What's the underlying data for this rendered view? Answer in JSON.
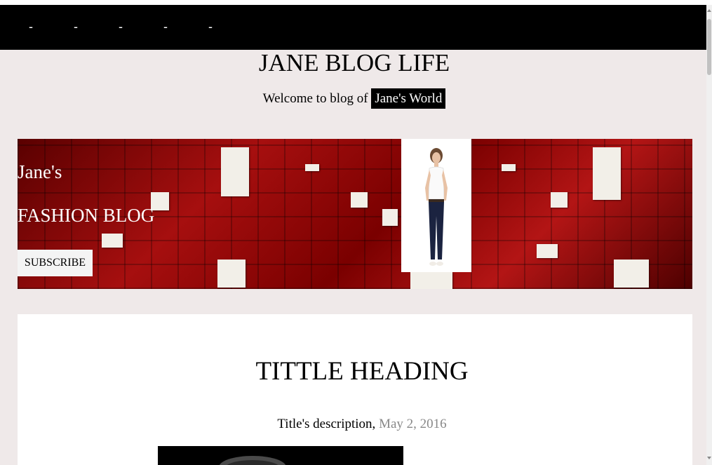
{
  "nav": {
    "items": [
      "-",
      "-",
      "-",
      "-",
      "-"
    ]
  },
  "header": {
    "title": "JANE BLOG LIFE",
    "welcome_text": "Welcome to blog of",
    "welcome_highlight": "Jane's World"
  },
  "banner": {
    "name": "Jane's",
    "subtitle": "FASHION BLOG",
    "subscribe_label": "SUBSCRIBE"
  },
  "post": {
    "title": "TITTLE HEADING",
    "description": "Title's description,",
    "date": "May 2, 2016"
  },
  "colors": {
    "nav_bg": "#000000",
    "page_bg": "#efe9e9",
    "banner_red": "#a60f0f",
    "date_gray": "#888888"
  }
}
